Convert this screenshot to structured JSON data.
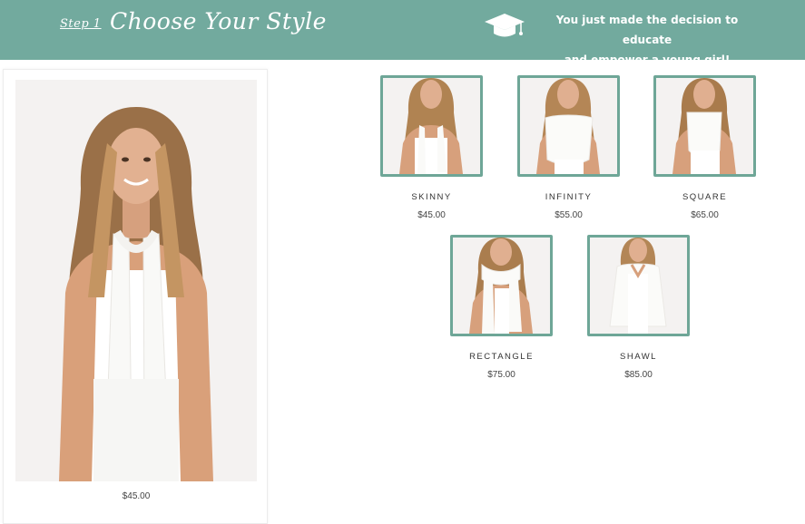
{
  "header": {
    "step_label": "Step 1",
    "title": "Choose Your Style",
    "tagline_line1": "You just made the decision to educate",
    "tagline_line2": "and empower a young girl!",
    "icon": "graduation-cap-icon",
    "bg_color": "#72aa9e"
  },
  "selected": {
    "price": "$45.00"
  },
  "options": [
    {
      "name": "SKINNY",
      "price": "$45.00",
      "scarf": "skinny"
    },
    {
      "name": "INFINITY",
      "price": "$55.00",
      "scarf": "infinity"
    },
    {
      "name": "SQUARE",
      "price": "$65.00",
      "scarf": "square"
    },
    {
      "name": "RECTANGLE",
      "price": "$75.00",
      "scarf": "rectangle"
    },
    {
      "name": "SHAWL",
      "price": "$85.00",
      "scarf": "shawl"
    }
  ],
  "colors": {
    "thumb_border": "#6ea697",
    "photo_bg": "#f4f2f1"
  }
}
